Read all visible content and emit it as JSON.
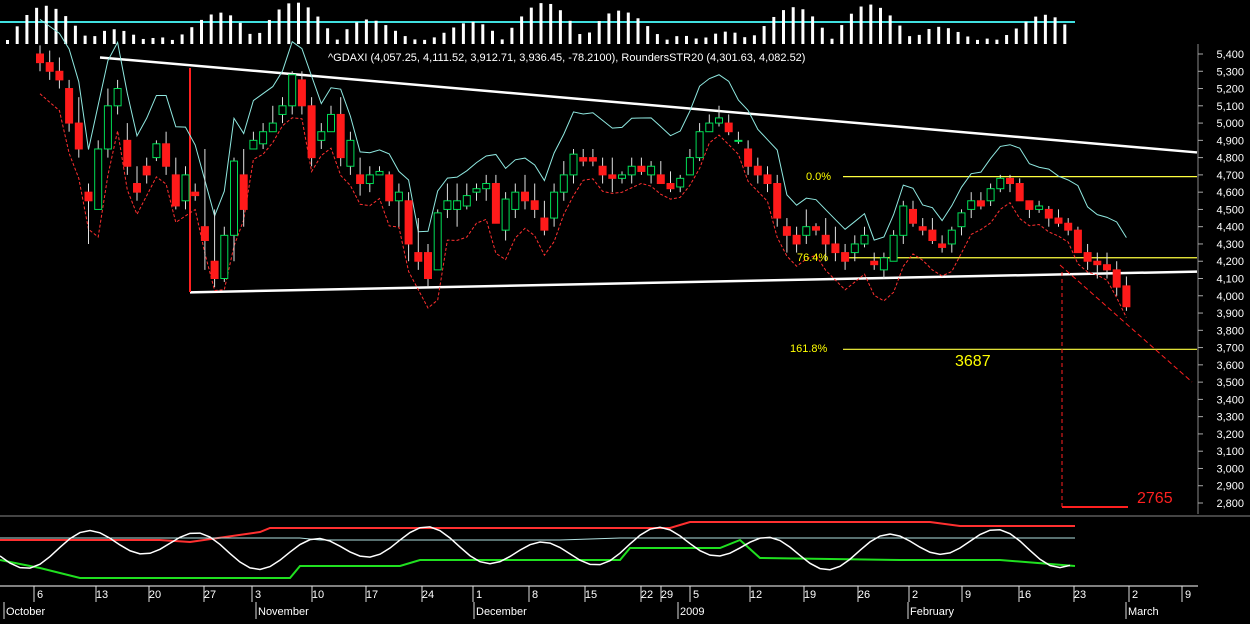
{
  "header": {
    "legend_text": "^GDAXI (4,057.25, 4,111.52, 3,912.71, 3,936.45, -78.2100), RoundersSTR20 (4,301.63, 4,082.52)"
  },
  "annotations": {
    "fib_0": "0.0%",
    "fib_764": "76.4%",
    "fib_1618": "161.8%",
    "target_3687": "3687",
    "target_2765": "2765"
  },
  "chart_data": {
    "type": "candlestick",
    "title": "^GDAXI (4,057.25, 4,111.52, 3,912.71, 3,936.45, -78.2100), RoundersSTR20 (4,301.63, 4,082.52)",
    "last_candle": {
      "open": 4057.25,
      "high": 4111.52,
      "low": 3912.71,
      "close": 3936.45,
      "change": -78.21
    },
    "indicator": {
      "name": "RoundersSTR20",
      "values": [
        4301.63,
        4082.52
      ]
    },
    "y_axis": {
      "min": 2700,
      "max": 5450,
      "ticks": [
        2800,
        2900,
        3000,
        3100,
        3200,
        3300,
        3400,
        3500,
        3600,
        3700,
        3800,
        3900,
        4000,
        4100,
        4200,
        4300,
        4400,
        4500,
        4600,
        4700,
        4800,
        4900,
        5000,
        5100,
        5200,
        5300,
        5400
      ]
    },
    "x_axis": {
      "day_ticks": [
        "6",
        "13",
        "20",
        "27",
        "3",
        "10",
        "17",
        "24",
        "1",
        "8",
        "15",
        "22",
        "29",
        "5",
        "12",
        "19",
        "26",
        "2",
        "9",
        "16",
        "23",
        "2",
        "9"
      ],
      "month_labels": [
        "October",
        "November",
        "December",
        "2009",
        "February",
        "March"
      ]
    },
    "levels": [
      {
        "label": "0.0%",
        "value": 4690
      },
      {
        "label": "76.4%",
        "value": 4220
      },
      {
        "label": "161.8%",
        "value": 3690
      }
    ],
    "targets": [
      3687,
      2765
    ],
    "candles": [
      [
        5400,
        5450,
        5300,
        5350
      ],
      [
        5350,
        5420,
        5250,
        5300
      ],
      [
        5300,
        5380,
        5200,
        5250
      ],
      [
        5200,
        5250,
        4950,
        5000
      ],
      [
        5000,
        5150,
        4800,
        4850
      ],
      [
        4600,
        4650,
        4300,
        4550
      ],
      [
        4500,
        4900,
        4550,
        4850
      ],
      [
        4850,
        5200,
        4800,
        5100
      ],
      [
        5100,
        5250,
        5050,
        5200
      ],
      [
        4900,
        5000,
        4700,
        4750
      ],
      [
        4650,
        4750,
        4550,
        4600
      ],
      [
        4750,
        4800,
        4650,
        4700
      ],
      [
        4800,
        4900,
        4780,
        4880
      ],
      [
        4880,
        4950,
        4700,
        4750
      ],
      [
        4700,
        4800,
        4500,
        4520
      ],
      [
        4550,
        4750,
        4500,
        4700
      ],
      [
        4600,
        4650,
        4550,
        4580
      ],
      [
        4400,
        4850,
        4150,
        4320
      ],
      [
        4200,
        4500,
        4050,
        4100
      ],
      [
        4100,
        4400,
        4080,
        4350
      ],
      [
        4350,
        4800,
        4200,
        4780
      ],
      [
        4700,
        4850,
        4400,
        4500
      ],
      [
        4850,
        4950,
        4850,
        4900
      ],
      [
        4880,
        5000,
        4850,
        4950
      ],
      [
        4950,
        5100,
        4950,
        5000
      ],
      [
        5050,
        5150,
        5000,
        5100
      ],
      [
        5100,
        5300,
        5050,
        5280
      ],
      [
        5250,
        5300,
        5050,
        5100
      ],
      [
        5100,
        5150,
        4750,
        4800
      ],
      [
        4900,
        5000,
        4850,
        4950
      ],
      [
        4950,
        5100,
        4950,
        5050
      ],
      [
        5050,
        5150,
        4750,
        4800
      ],
      [
        4750,
        4950,
        4700,
        4900
      ],
      [
        4700,
        4800,
        4580,
        4650
      ],
      [
        4650,
        4750,
        4600,
        4700
      ],
      [
        4700,
        4750,
        4700,
        4720
      ],
      [
        4700,
        4720,
        4520,
        4550
      ],
      [
        4550,
        4650,
        4400,
        4600
      ],
      [
        4550,
        4600,
        4200,
        4300
      ],
      [
        4250,
        4450,
        4150,
        4200
      ],
      [
        4250,
        4300,
        4050,
        4100
      ],
      [
        4150,
        4500,
        4150,
        4480
      ],
      [
        4500,
        4650,
        4450,
        4550
      ],
      [
        4500,
        4650,
        4400,
        4550
      ],
      [
        4520,
        4650,
        4500,
        4580
      ],
      [
        4600,
        4650,
        4550,
        4620
      ],
      [
        4620,
        4700,
        4550,
        4650
      ],
      [
        4650,
        4700,
        4450,
        4420
      ],
      [
        4380,
        4600,
        4320,
        4560
      ],
      [
        4500,
        4650,
        4450,
        4600
      ],
      [
        4600,
        4700,
        4500,
        4550
      ],
      [
        4550,
        4650,
        4450,
        4500
      ],
      [
        4450,
        4550,
        4350,
        4380
      ],
      [
        4450,
        4650,
        4400,
        4600
      ],
      [
        4600,
        4780,
        4550,
        4700
      ],
      [
        4700,
        4850,
        4650,
        4820
      ],
      [
        4800,
        4850,
        4750,
        4780
      ],
      [
        4800,
        4850,
        4750,
        4780
      ],
      [
        4750,
        4800,
        4650,
        4700
      ],
      [
        4700,
        4800,
        4600,
        4680
      ],
      [
        4680,
        4720,
        4650,
        4700
      ],
      [
        4700,
        4800,
        4650,
        4750
      ],
      [
        4750,
        4800,
        4700,
        4720
      ],
      [
        4700,
        4780,
        4650,
        4750
      ],
      [
        4700,
        4780,
        4650,
        4650
      ],
      [
        4650,
        4720,
        4600,
        4620
      ],
      [
        4630,
        4700,
        4600,
        4680
      ],
      [
        4700,
        4850,
        4700,
        4800
      ],
      [
        4800,
        5000,
        4780,
        4950
      ],
      [
        4950,
        5050,
        4950,
        5000
      ],
      [
        5000,
        5100,
        4980,
        5030
      ],
      [
        5000,
        5050,
        4930,
        4950
      ],
      [
        4900,
        4950,
        4880,
        4900
      ],
      [
        4850,
        4900,
        4700,
        4750
      ],
      [
        4750,
        4800,
        4650,
        4700
      ],
      [
        4700,
        4750,
        4600,
        4650
      ],
      [
        4650,
        4700,
        4400,
        4450
      ],
      [
        4400,
        4450,
        4250,
        4350
      ],
      [
        4350,
        4400,
        4250,
        4300
      ],
      [
        4350,
        4500,
        4300,
        4400
      ],
      [
        4400,
        4420,
        4350,
        4380
      ],
      [
        4350,
        4450,
        4200,
        4300
      ],
      [
        4300,
        4400,
        4200,
        4250
      ],
      [
        4250,
        4300,
        4150,
        4200
      ],
      [
        4250,
        4350,
        4200,
        4300
      ],
      [
        4300,
        4400,
        4280,
        4350
      ],
      [
        4200,
        4250,
        4150,
        4180
      ],
      [
        4150,
        4250,
        4100,
        4220
      ],
      [
        4200,
        4380,
        4200,
        4350
      ],
      [
        4350,
        4550,
        4300,
        4520
      ],
      [
        4500,
        4550,
        4400,
        4420
      ],
      [
        4400,
        4450,
        4350,
        4380
      ],
      [
        4380,
        4450,
        4300,
        4320
      ],
      [
        4300,
        4350,
        4250,
        4280
      ],
      [
        4300,
        4400,
        4250,
        4380
      ],
      [
        4400,
        4500,
        4350,
        4480
      ],
      [
        4500,
        4600,
        4450,
        4550
      ],
      [
        4550,
        4600,
        4500,
        4520
      ],
      [
        4550,
        4650,
        4520,
        4620
      ],
      [
        4620,
        4700,
        4600,
        4680
      ],
      [
        4680,
        4700,
        4600,
        4650
      ],
      [
        4650,
        4680,
        4550,
        4550
      ],
      [
        4550,
        4550,
        4450,
        4500
      ],
      [
        4500,
        4550,
        4480,
        4520
      ],
      [
        4500,
        4520,
        4400,
        4450
      ],
      [
        4450,
        4500,
        4400,
        4420
      ],
      [
        4420,
        4450,
        4350,
        4380
      ],
      [
        4380,
        4400,
        4300,
        4250
      ],
      [
        4250,
        4300,
        4150,
        4200
      ],
      [
        4200,
        4250,
        4100,
        4180
      ],
      [
        4180,
        4250,
        4100,
        4150
      ],
      [
        4150,
        4200,
        4000,
        4050
      ],
      [
        4057.25,
        4111.52,
        3912.71,
        3936.45
      ]
    ],
    "trendlines": [
      {
        "name": "upper",
        "from": [
          0,
          5380
        ],
        "to": [
          140,
          4830
        ]
      },
      {
        "name": "lower",
        "from": [
          18,
          4020
        ],
        "to": [
          140,
          4140
        ]
      }
    ]
  }
}
